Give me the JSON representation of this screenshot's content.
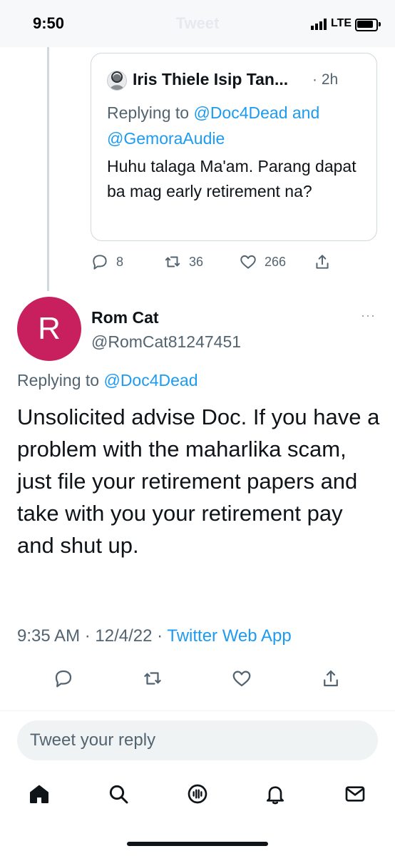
{
  "status_bar": {
    "time": "9:50",
    "faded_title": "Tweet",
    "carrier": "LTE"
  },
  "quoted_tweet": {
    "name": "Iris Thiele Isip Tan...",
    "time": "· 2h",
    "replying_prefix": "Replying to ",
    "replying_to_1": "@Doc4Dead",
    "replying_and": " and ",
    "replying_to_2": "@GemoraAudie",
    "text": "Huhu talaga Ma'am. Parang dapat ba mag early retirement na?",
    "reply_count": "8",
    "retweet_count": "36",
    "like_count": "266"
  },
  "tweet": {
    "avatar_letter": "R",
    "name": "Rom Cat",
    "handle": "@RomCat81247451",
    "more": "···",
    "replying_prefix": "Replying to ",
    "replying_to": "@Doc4Dead",
    "text": "Unsolicited advise Doc. If you have a problem with the maharlika scam, just file your retirement papers and take with you your retirement pay and shut up.",
    "timestamp": "9:35 AM · 12/4/22 · ",
    "source": "Twitter Web App"
  },
  "reply_box": {
    "placeholder": "Tweet your reply"
  },
  "colors": {
    "accent": "#1d9bf0",
    "avatar": "#c8205e",
    "muted": "#536471"
  },
  "icons": [
    "reply-icon",
    "retweet-icon",
    "like-icon",
    "share-icon",
    "home-icon",
    "search-icon",
    "spaces-icon",
    "notifications-icon",
    "messages-icon"
  ]
}
